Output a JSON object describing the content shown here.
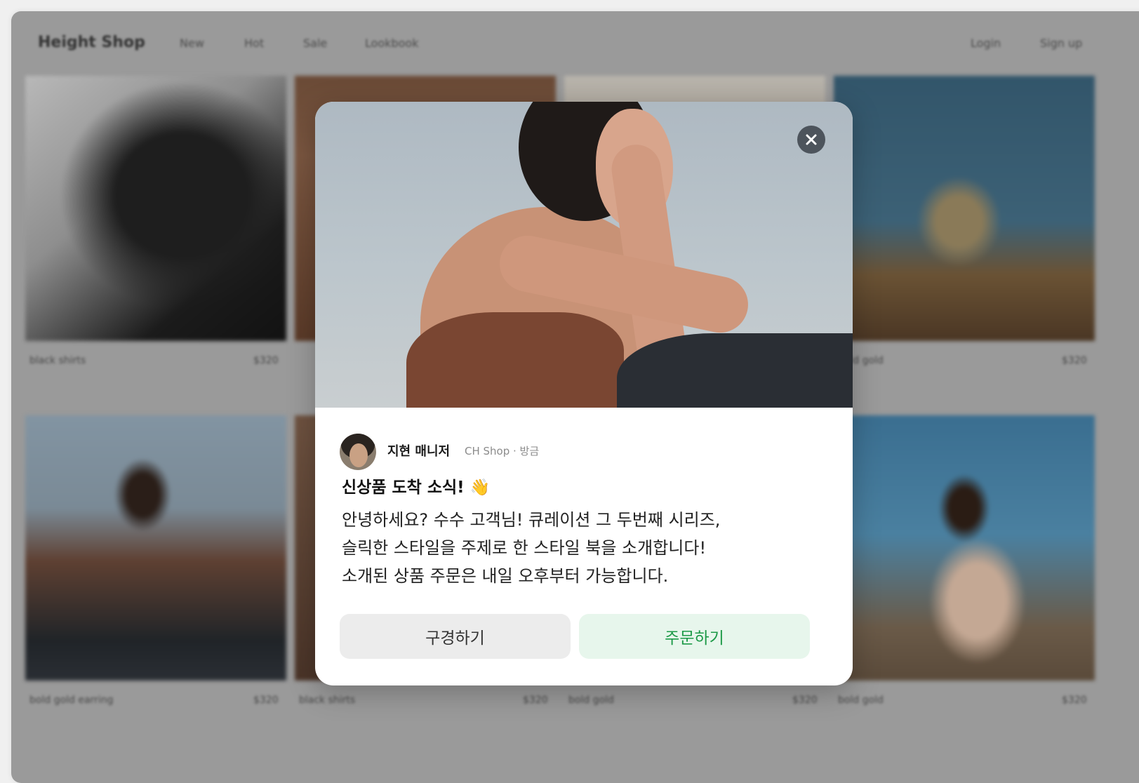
{
  "header": {
    "brand": "Height Shop",
    "nav": [
      "New",
      "Hot",
      "Sale",
      "Lookbook"
    ],
    "login": "Login",
    "signup": "Sign up"
  },
  "products": [
    {
      "name": "black shirts",
      "price": "$320"
    },
    {
      "name": "",
      "price": ""
    },
    {
      "name": "",
      "price": ""
    },
    {
      "name": "bold gold",
      "price": "$320"
    },
    {
      "name": "bold gold earring",
      "price": "$320"
    },
    {
      "name": "black shirts",
      "price": "$320"
    },
    {
      "name": "bold gold",
      "price": "$320"
    },
    {
      "name": "bold gold",
      "price": "$320"
    }
  ],
  "modal": {
    "author": "지현 매니저",
    "meta": "CH Shop · 방금",
    "title": "신상품 도착 소식! 👋",
    "body_lines": [
      "안녕하세요? 수수 고객님! 큐레이션 그 두번째 시리즈,",
      "슬릭한 스타일을 주제로 한 스타일 북을 소개합니다!",
      "소개된 상품 주문은 내일 오후부터 가능합니다."
    ],
    "browse_label": "구경하기",
    "order_label": "주문하기",
    "close_icon": "close-icon"
  },
  "colors": {
    "order_accent": "#1d9a48",
    "order_bg": "#e7f6ec",
    "close_bg": "#4d545c"
  }
}
